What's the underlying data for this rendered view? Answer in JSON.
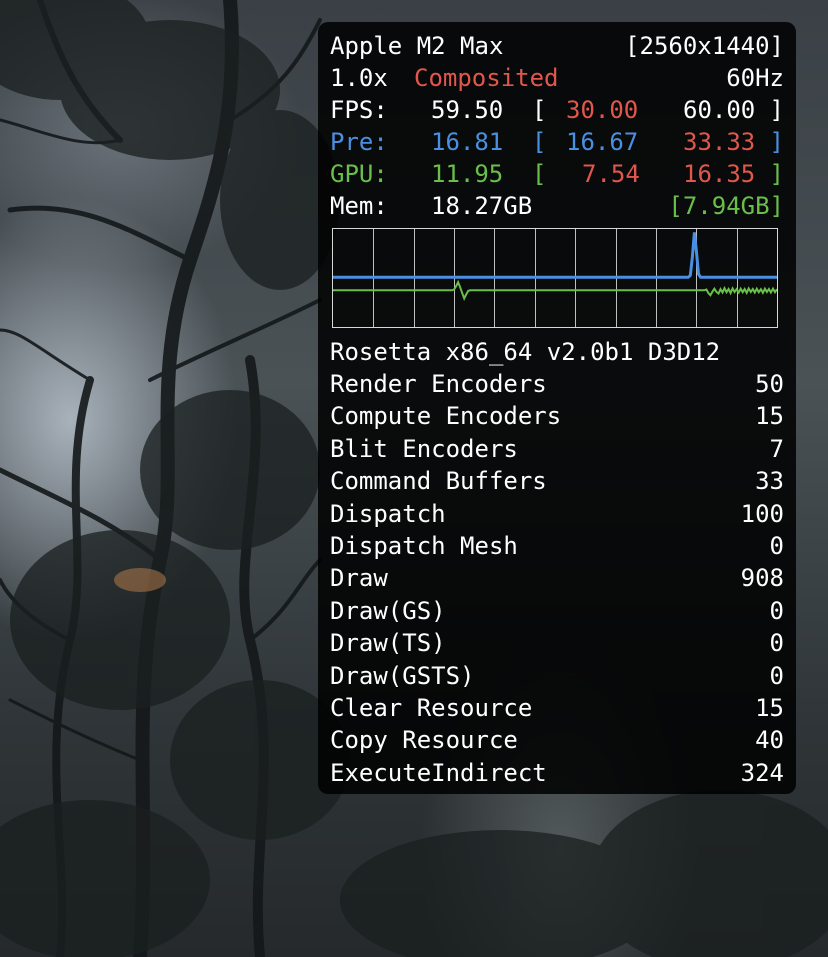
{
  "colors": {
    "white": "#ffffff",
    "red": "#e2574c",
    "blue": "#4a90e2",
    "green": "#6abf4b",
    "hud_bg": "rgba(0,0,0,0.86)"
  },
  "hud": {
    "device": "Apple M2 Max",
    "resolution": "[2560x1440]",
    "scale": "1.0x",
    "mode": "Composited",
    "refresh": "60Hz",
    "fps": {
      "label": "FPS:",
      "value": "59.50",
      "open": "[",
      "min": "30.00",
      "max": "60.00",
      "close": "]"
    },
    "pre": {
      "label": "Pre:",
      "value": "16.81",
      "open": "[",
      "min": "16.67",
      "max": "33.33",
      "close": "]"
    },
    "gpu": {
      "label": "GPU:",
      "value": "11.95",
      "open": "[",
      "min": "7.54",
      "max": "16.35",
      "close": "]"
    },
    "mem": {
      "label": "Mem:",
      "value": "18.27GB",
      "extra": "[7.94GB]"
    },
    "graph": {
      "pre_series": [
        16.8,
        16.8,
        16.8,
        16.8,
        16.8,
        16.8,
        16.8,
        16.8,
        16.8,
        16.8,
        16.8,
        16.8,
        16.8,
        16.8,
        16.8,
        16.8,
        16.8,
        16.8,
        16.8,
        16.8,
        16.8,
        16.8,
        16.8,
        16.8,
        16.8,
        16.8,
        16.8,
        16.8,
        16.8,
        16.8,
        16.8,
        16.8,
        16.8,
        16.8,
        16.8,
        16.8,
        16.8,
        16.8,
        16.8,
        16.8,
        16.8,
        16.8,
        16.8,
        16.8,
        16.8,
        16.8,
        16.8,
        16.8,
        16.8,
        16.8,
        16.8,
        16.8,
        16.8,
        16.8,
        16.8,
        16.8,
        16.8,
        16.8,
        16.8,
        16.8,
        16.8,
        16.8,
        16.8,
        16.8,
        16.8,
        16.8,
        16.8,
        16.8,
        16.8,
        16.8,
        16.8,
        16.8,
        16.8,
        16.8,
        16.8,
        16.8,
        16.8,
        16.8,
        16.8,
        16.8,
        16.8,
        16.8,
        16.8,
        16.8,
        16.8,
        16.8,
        16.8,
        16.8,
        16.8,
        16.8,
        16.8,
        16.8,
        16.8,
        16.8,
        16.8,
        16.8,
        16.8,
        16.8,
        16.8,
        16.8,
        16.8,
        16.8,
        16.8,
        16.8,
        16.8,
        16.8,
        16.8,
        16.8,
        16.8,
        16.8,
        16.8,
        16.8,
        16.8,
        16.8,
        16.8,
        16.8,
        16.8,
        16.8,
        16.8,
        16.8,
        16.8,
        16.8,
        16.8,
        16.8,
        16.8,
        16.8,
        16.8,
        16.8,
        16.8,
        16.8,
        16.8,
        16.8,
        16.8,
        16.8,
        16.8,
        16.8,
        16.8,
        16.8,
        16.8,
        16.8,
        16.8,
        16.8,
        16.8,
        16.8,
        16.8,
        16.8,
        16.8,
        16.8,
        16.8,
        16.8,
        16.8,
        16.8,
        16.8,
        16.8,
        16.8,
        16.8,
        16.8,
        16.8,
        16.8,
        16.8,
        16.8,
        16.8,
        16.8,
        16.8,
        16.8,
        16.8,
        16.8,
        16.8,
        16.8,
        16.8,
        16.8,
        16.8,
        16.8,
        17.5,
        24.0,
        33.3,
        26.0,
        18.0,
        16.8,
        16.8,
        16.8,
        16.8,
        16.8,
        16.8,
        16.8,
        16.8,
        16.8,
        16.8,
        16.8,
        16.8,
        16.8,
        16.8,
        16.8,
        16.8,
        16.8,
        16.8,
        16.8,
        16.8,
        16.8,
        16.8,
        16.8,
        16.8,
        16.8,
        16.8,
        16.8,
        16.8,
        16.8,
        16.8,
        16.8,
        16.8,
        16.8,
        16.8,
        16.8,
        16.8,
        16.8,
        16.8
      ],
      "gpu_series_note": "",
      "gpu_series": [
        12.0,
        12.0,
        12.0,
        12.0,
        12.0,
        12.0,
        12.0,
        12.0,
        12.0,
        12.0,
        12.0,
        12.0,
        12.0,
        12.0,
        12.0,
        12.0,
        12.0,
        12.0,
        12.0,
        12.0,
        12.0,
        12.0,
        12.0,
        12.0,
        12.0,
        12.0,
        12.0,
        12.0,
        12.0,
        12.0,
        12.0,
        12.0,
        12.0,
        12.0,
        12.0,
        12.0,
        12.0,
        12.0,
        12.0,
        12.0,
        12.0,
        12.0,
        12.0,
        12.0,
        12.0,
        12.0,
        12.0,
        12.0,
        12.0,
        12.0,
        12.0,
        12.0,
        12.0,
        12.0,
        12.0,
        12.0,
        12.0,
        12.0,
        12.0,
        12.0,
        12.3,
        13.5,
        15.0,
        13.2,
        11.0,
        9.0,
        10.5,
        11.8,
        12.0,
        12.0,
        12.0,
        12.0,
        12.0,
        12.0,
        12.0,
        12.0,
        12.0,
        12.0,
        12.0,
        12.0,
        12.0,
        12.0,
        12.0,
        12.0,
        12.0,
        12.0,
        12.0,
        12.0,
        12.0,
        12.0,
        12.0,
        12.0,
        12.0,
        12.0,
        12.0,
        12.0,
        12.0,
        12.0,
        12.0,
        12.0,
        12.0,
        12.0,
        12.0,
        12.0,
        12.0,
        12.0,
        12.0,
        12.0,
        12.0,
        12.0,
        12.0,
        12.0,
        12.0,
        12.0,
        12.0,
        12.0,
        12.0,
        12.0,
        12.0,
        12.0,
        12.0,
        12.0,
        12.0,
        12.0,
        12.0,
        12.0,
        12.0,
        12.0,
        12.0,
        12.0,
        12.0,
        12.0,
        12.0,
        12.0,
        12.0,
        12.0,
        12.0,
        12.0,
        12.0,
        12.0,
        12.0,
        12.0,
        12.0,
        12.0,
        12.0,
        12.0,
        12.0,
        12.0,
        12.0,
        12.0,
        12.0,
        12.0,
        12.0,
        12.0,
        12.0,
        12.0,
        12.0,
        12.0,
        12.0,
        12.0,
        12.0,
        12.0,
        12.0,
        12.0,
        12.0,
        12.0,
        12.0,
        12.0,
        12.0,
        12.0,
        12.0,
        12.0,
        12.0,
        12.0,
        12.0,
        12.0,
        12.0,
        12.0,
        12.0,
        12.0,
        12.0,
        12.0,
        12.0,
        12.0,
        12.0,
        12.3,
        11.0,
        10.2,
        11.5,
        12.6,
        11.4,
        10.8,
        12.4,
        11.2,
        12.8,
        11.3,
        12.5,
        11.0,
        12.7,
        11.4,
        12.4,
        11.2,
        12.6,
        11.3,
        12.5,
        11.1,
        12.7,
        11.4,
        12.5,
        11.2,
        12.6,
        11.3,
        12.4,
        11.1,
        12.6,
        11.4,
        12.5,
        11.2,
        12.6,
        11.3,
        12.4
      ]
    },
    "api_line": "Rosetta x86_64 v2.0b1 D3D12",
    "stats": [
      {
        "label": "Render Encoders",
        "value": "50"
      },
      {
        "label": "Compute Encoders",
        "value": "15"
      },
      {
        "label": "Blit Encoders",
        "value": "7"
      },
      {
        "label": "Command Buffers",
        "value": "33"
      },
      {
        "label": "Dispatch",
        "value": "100"
      },
      {
        "label": "Dispatch Mesh",
        "value": "0"
      },
      {
        "label": "Draw",
        "value": "908"
      },
      {
        "label": "Draw(GS)",
        "value": "0"
      },
      {
        "label": "Draw(TS)",
        "value": "0"
      },
      {
        "label": "Draw(GSTS)",
        "value": "0"
      },
      {
        "label": "Clear Resource",
        "value": "15"
      },
      {
        "label": "Copy Resource",
        "value": "40"
      },
      {
        "label": "ExecuteIndirect",
        "value": "324"
      }
    ]
  }
}
